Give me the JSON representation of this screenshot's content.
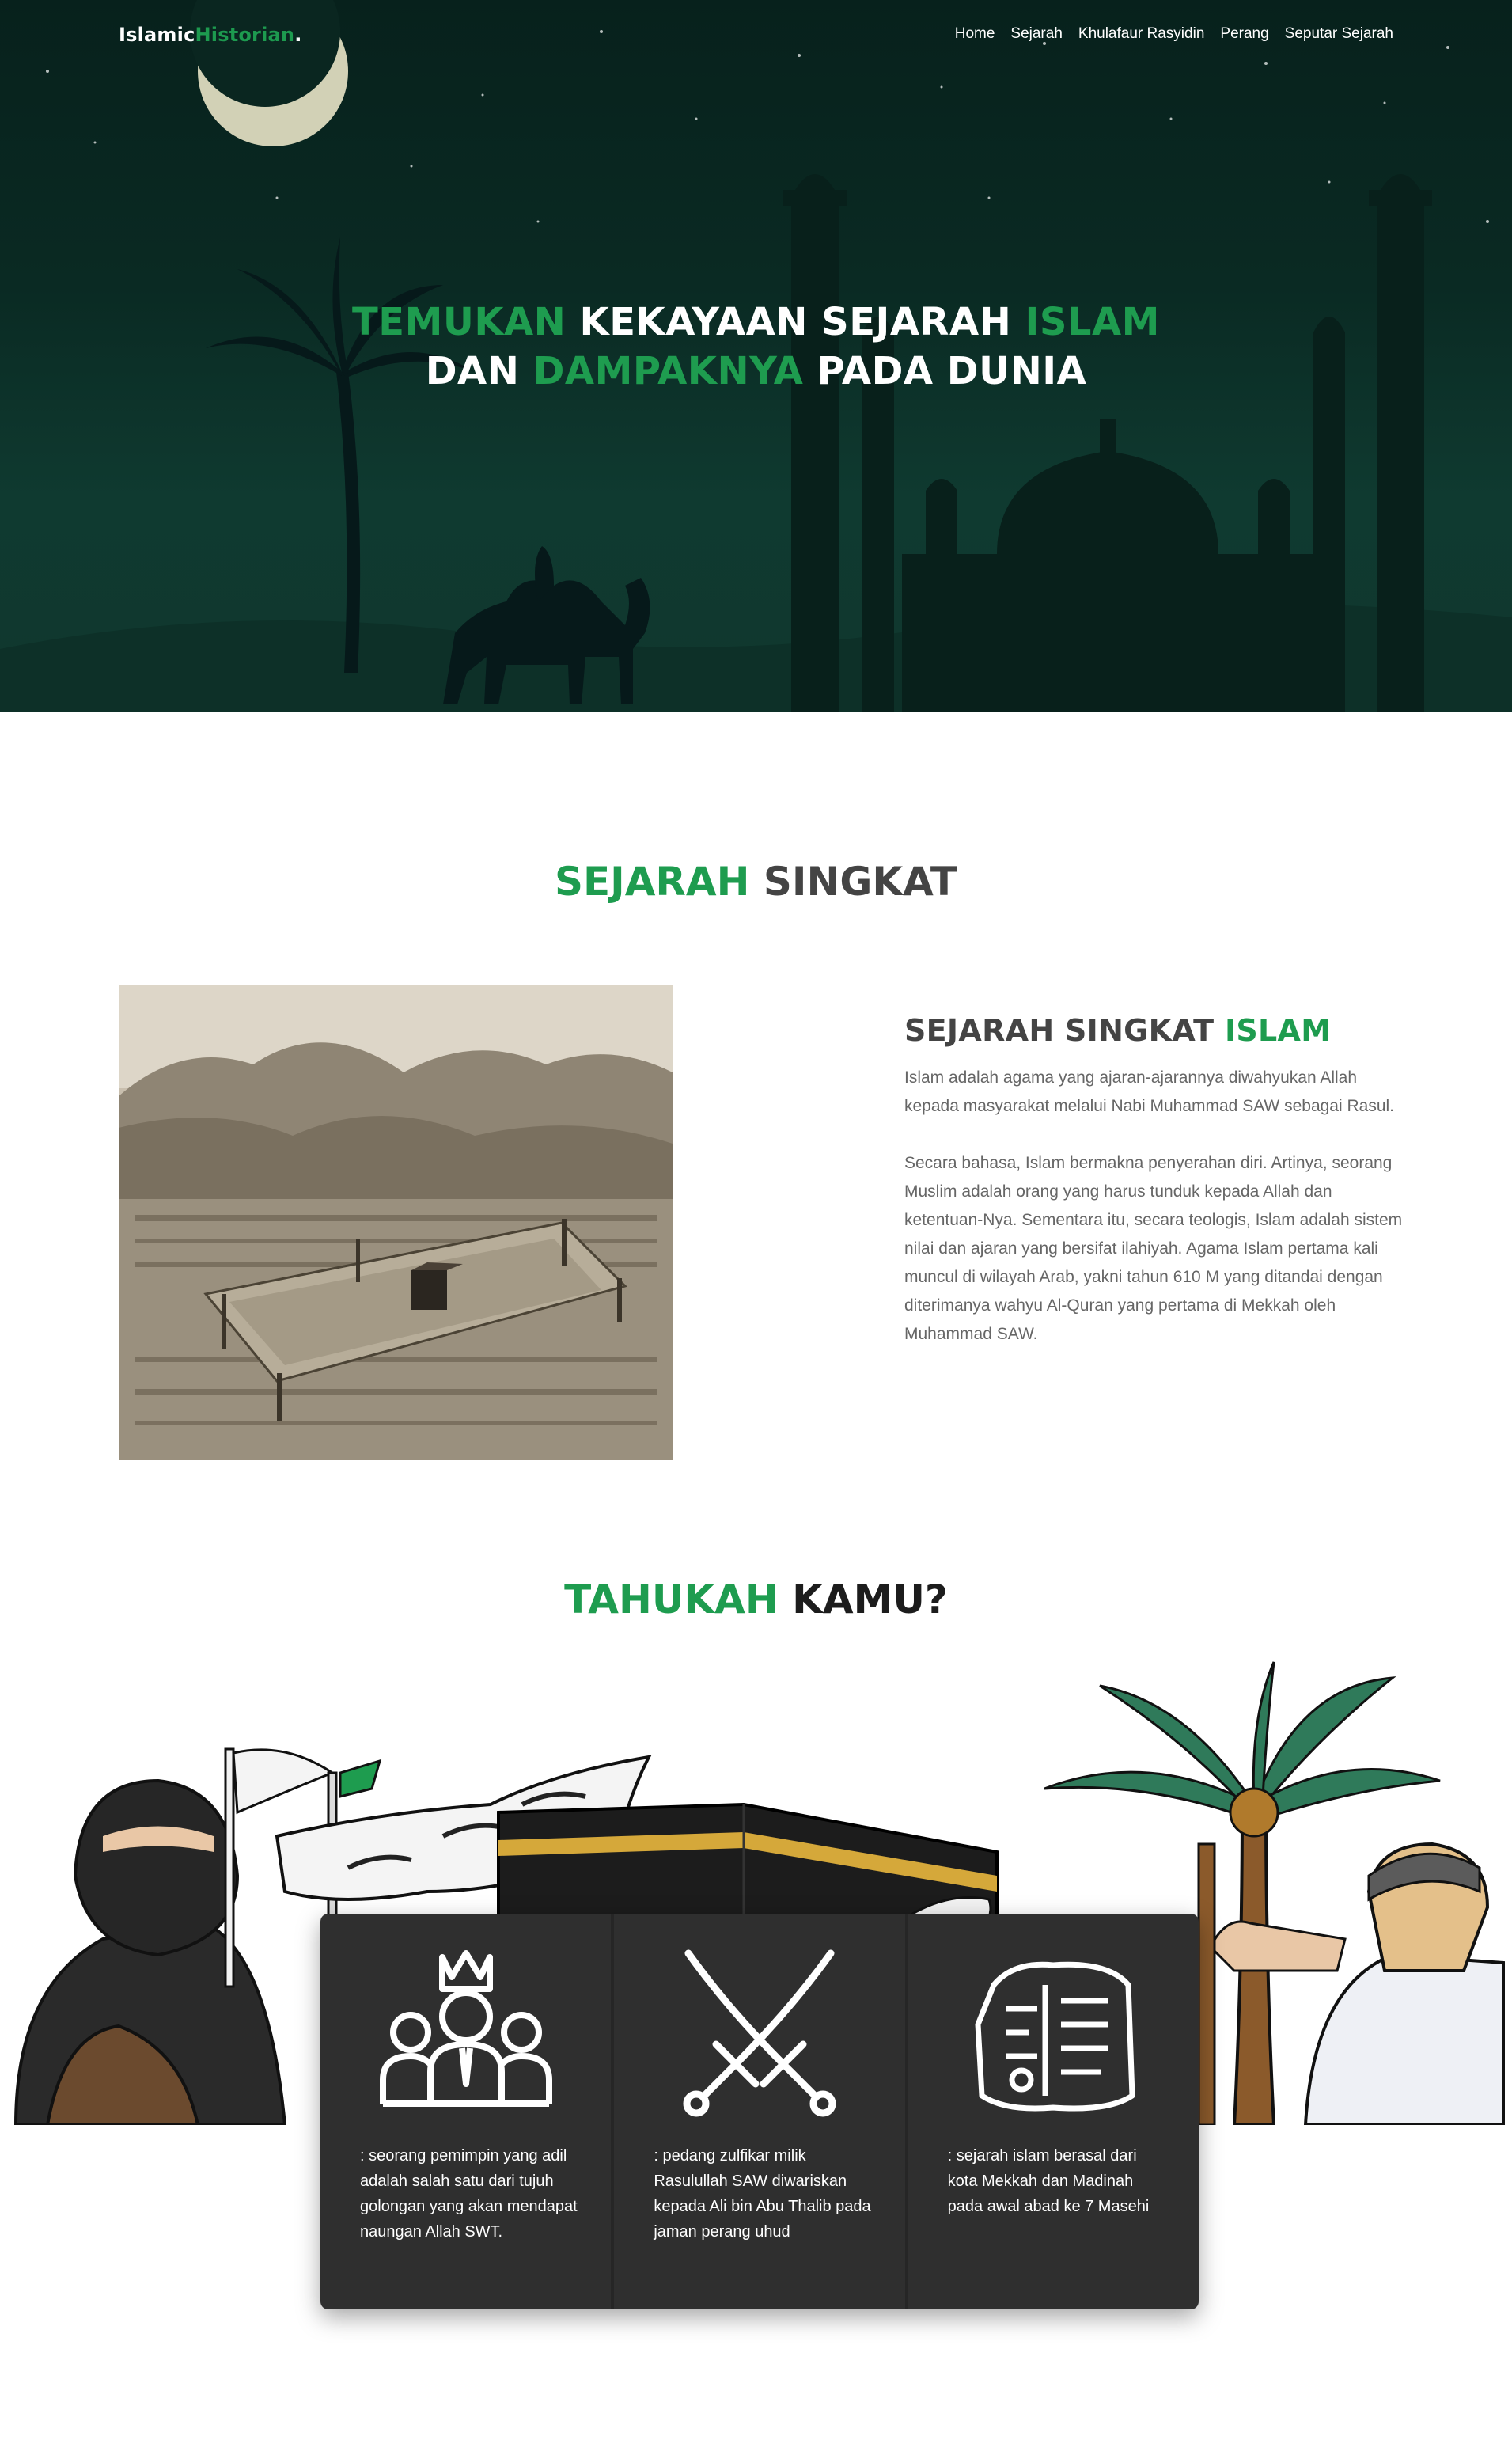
{
  "brand": {
    "part1": "Islamic",
    "part2": "Historian",
    "dot": "."
  },
  "nav": {
    "items": [
      {
        "label": "Home"
      },
      {
        "label": "Sejarah"
      },
      {
        "label": "Khulafaur Rasyidin"
      },
      {
        "label": "Perang"
      },
      {
        "label": "Seputar Sejarah"
      }
    ]
  },
  "hero": {
    "line1": {
      "w1": "TEMUKAN",
      "w2": " KEKAYAAN SEJARAH ",
      "w3": "ISLAM"
    },
    "line2": {
      "w1": "DAN ",
      "w2": "DAMPAKNYA",
      "w3": " PADA DUNIA"
    }
  },
  "section_history": {
    "title_green": "SEJARAH",
    "title_rest": " SINGKAT",
    "heading_dark": "SEJARAH SINGKAT ",
    "heading_green": "ISLAM",
    "paragraph1": "Islam adalah agama yang ajaran-ajarannya diwahyukan Allah kepada masyarakat melalui Nabi Muhammad SAW sebagai Rasul.",
    "paragraph2": "Secara bahasa, Islam bermakna penyerahan diri. Artinya, seorang Muslim adalah orang yang harus tunduk kepada Allah dan ketentuan-Nya. Sementara itu, secara teologis, Islam adalah sistem nilai dan ajaran yang bersifat ilahiyah. Agama Islam pertama kali muncul di wilayah Arab, yakni tahun 610 M yang ditandai dengan diterimanya wahyu Al-Quran yang pertama di Mekkah oleh Muhammad SAW."
  },
  "section_facts": {
    "title_green": "TAHUKAH",
    "title_rest": " KAMU?",
    "cards": [
      {
        "icon": "leaders-icon",
        "text": ": seorang pemimpin yang adil adalah salah satu dari tujuh golongan yang akan mendapat naungan Allah SWT."
      },
      {
        "icon": "crossed-swords-icon",
        "text": ": pedang zulfikar milik Rasulullah SAW diwariskan kepada Ali bin Abu Thalib pada jaman perang uhud"
      },
      {
        "icon": "ancient-tablet-icon",
        "text": ": sejarah islam berasal dari kota Mekkah dan Madinah pada awal abad ke 7 Masehi"
      }
    ]
  },
  "colors": {
    "accent": "#1e9c4f",
    "hero_bg": "#0b2b24",
    "card_bg": "#2f2f2f",
    "heading": "#444444"
  }
}
